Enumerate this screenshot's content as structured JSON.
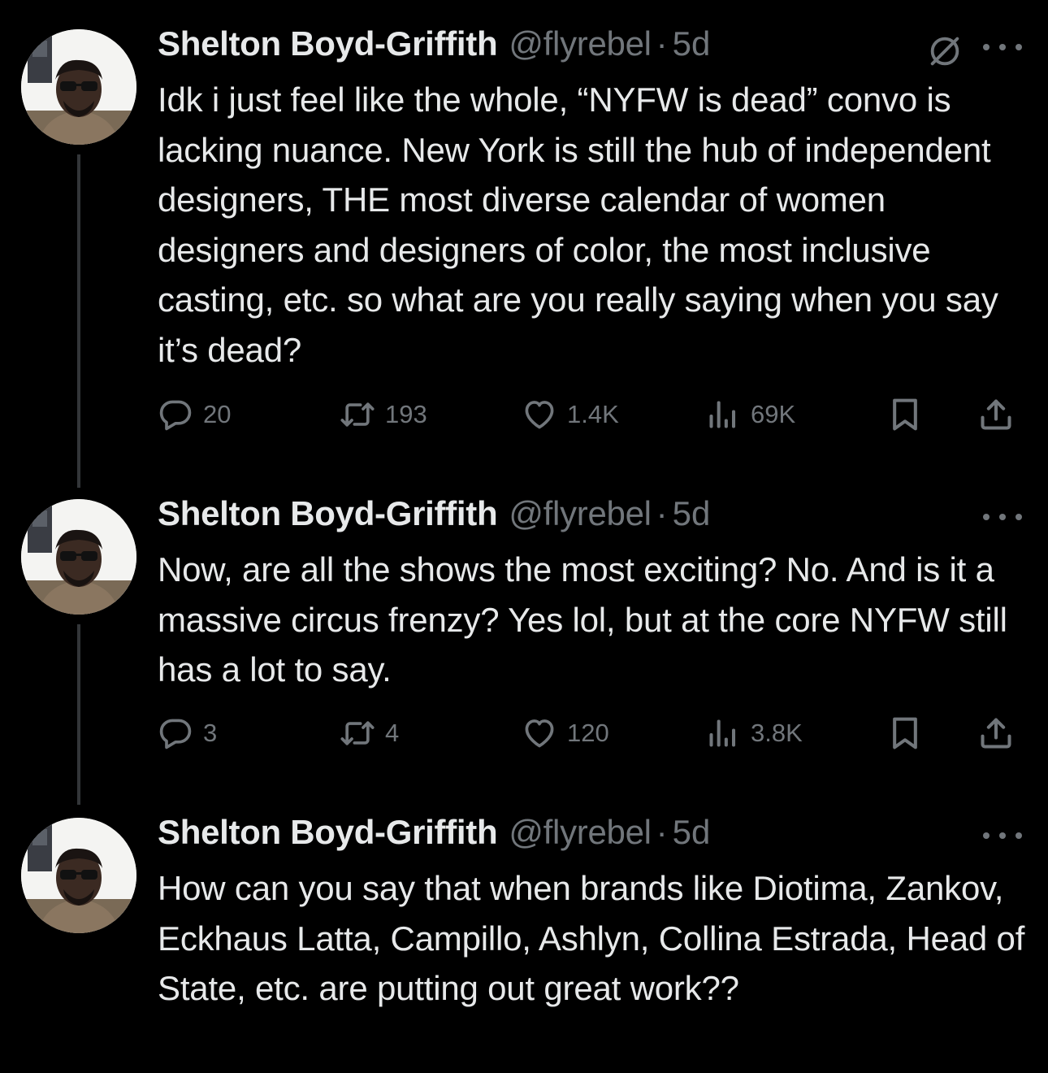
{
  "tweets": [
    {
      "name": "Shelton Boyd-Griffith",
      "handle": "@flyrebel",
      "dot": "·",
      "time": "5d",
      "text": "Idk i just feel like the whole, “NYFW is dead” convo is lacking nuance. New York is still the hub of independent designers, THE most diverse calendar of women designers and designers of color, the most inclusive casting, etc. so what are you really saying when you say it’s dead?",
      "replies": "20",
      "retweets": "193",
      "likes": "1.4K",
      "views": "69K"
    },
    {
      "name": "Shelton Boyd-Griffith",
      "handle": "@flyrebel",
      "dot": "·",
      "time": "5d",
      "text": "Now, are all the shows the most exciting? No. And is it a massive circus frenzy? Yes lol, but at the core NYFW still has a lot to say.",
      "replies": "3",
      "retweets": "4",
      "likes": "120",
      "views": "3.8K"
    },
    {
      "name": "Shelton Boyd-Griffith",
      "handle": "@flyrebel",
      "dot": "·",
      "time": "5d",
      "text": "How can you say that when brands like Diotima, Zankov, Eckhaus Latta, Campillo, Ashlyn, Collina Estrada, Head of State, etc. are putting out great work??"
    }
  ],
  "icons": {
    "reply": "reply-icon",
    "retweet": "retweet-icon",
    "like": "heart-icon",
    "views": "views-icon",
    "bookmark": "bookmark-icon",
    "share": "share-icon",
    "more": "more-icon",
    "hidden": "hidden-reply-icon"
  },
  "colors": {
    "background": "#000000",
    "text": "#e7e9ea",
    "muted": "#71767b",
    "thread_line": "#333639"
  }
}
